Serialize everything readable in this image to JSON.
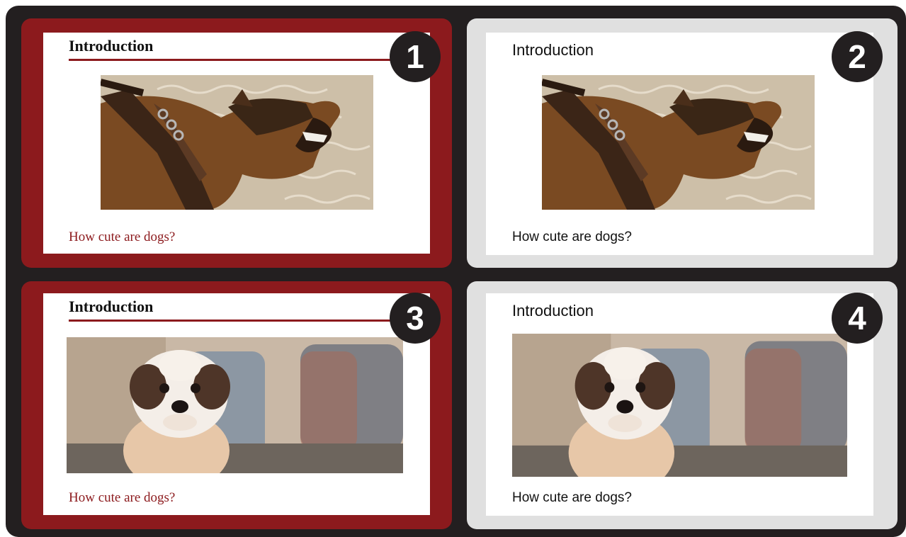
{
  "colors": {
    "background_frame": "#231f20",
    "accent_red": "#8c1a1d",
    "panel_gray": "#e0e0e0",
    "slide_white": "#ffffff"
  },
  "panels": [
    {
      "number": "1",
      "title": "Introduction",
      "caption": "How cute are dogs?",
      "image": "angry-dog-photo",
      "style": "serif-red"
    },
    {
      "number": "2",
      "title": "Introduction",
      "caption": "How cute are dogs?",
      "image": "angry-dog-photo",
      "style": "sans-plain"
    },
    {
      "number": "3",
      "title": "Introduction",
      "caption": "How cute are dogs?",
      "image": "puppy-photo",
      "style": "serif-red"
    },
    {
      "number": "4",
      "title": "Introduction",
      "caption": "How cute are dogs?",
      "image": "puppy-photo",
      "style": "sans-plain"
    }
  ]
}
